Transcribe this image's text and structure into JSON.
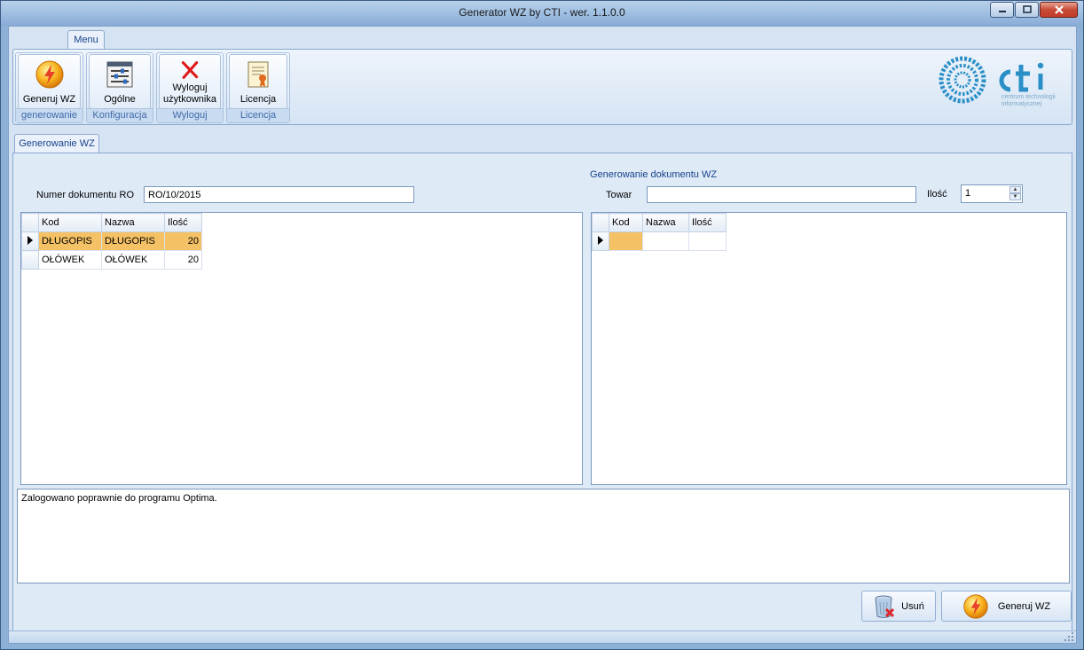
{
  "window": {
    "title": "Generator WZ by CTI -  wer. 1.1.0.0",
    "minimize_icon": "minimize-icon",
    "maximize_icon": "maximize-icon",
    "close_icon": "close-icon"
  },
  "ribbon": {
    "tab_label": "Menu",
    "groups": [
      {
        "button_label": "Generuj WZ",
        "group_label": "generowanie",
        "icon": "lightning-icon"
      },
      {
        "button_label": "Ogólne",
        "group_label": "Konfiguracja",
        "icon": "settings-sliders-icon"
      },
      {
        "button_label": "Wyloguj\nużytkownika",
        "group_label": "Wyloguj",
        "icon": "red-x-icon"
      },
      {
        "button_label": "Licencja",
        "group_label": "Licencja",
        "icon": "certificate-icon"
      }
    ]
  },
  "logo": {
    "name": "cti",
    "tagline_line1": "centrum technologii",
    "tagline_line2": "informatycznej",
    "color": "#2a8fc7"
  },
  "document_tab": "Generowanie WZ",
  "form": {
    "section_title": "Generowanie dokumentu WZ",
    "numer_label": "Numer dokumentu RO",
    "numer_value": "RO/10/2015",
    "towar_label": "Towar",
    "towar_value": "",
    "ilosc_label": "Ilość",
    "ilosc_value": "1"
  },
  "left_grid": {
    "columns": [
      "Kod",
      "Nazwa",
      "Ilość"
    ],
    "rows": [
      {
        "kod": "DŁUGOPIS",
        "nazwa": "DŁUGOPIS",
        "ilosc": "20",
        "selected": true
      },
      {
        "kod": "OŁÓWEK",
        "nazwa": "OŁÓWEK",
        "ilosc": "20",
        "selected": false
      }
    ]
  },
  "right_grid": {
    "columns": [
      "Kod",
      "Nazwa",
      "Ilość"
    ],
    "rows": [
      {
        "kod": "",
        "nazwa": "",
        "ilosc": "",
        "selected": true
      }
    ]
  },
  "log": {
    "text": "Zalogowano poprawnie do programu Optima."
  },
  "actions": {
    "delete_label": "Usuń",
    "delete_icon": "trash-icon",
    "generate_label": "Generuj WZ",
    "generate_icon": "lightning-icon"
  },
  "colors": {
    "selection": "#f4c164",
    "accent_text": "#15428b"
  }
}
